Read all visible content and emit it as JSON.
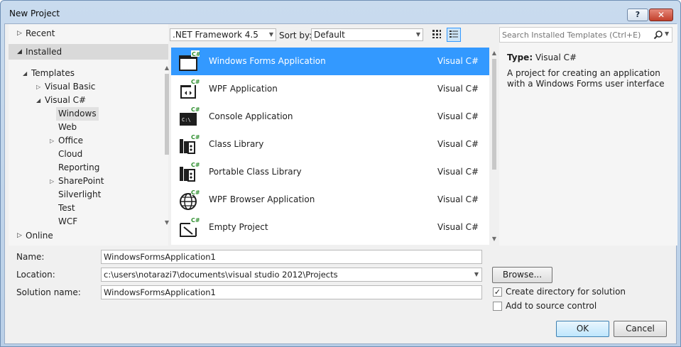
{
  "window": {
    "title": "New Project",
    "help_label": "?",
    "close_label": "✕"
  },
  "nav": {
    "recent": "Recent",
    "installed": "Installed",
    "online": "Online",
    "tree": [
      {
        "label": "Templates",
        "arrow": "◢"
      },
      {
        "label": "Visual Basic",
        "arrow": "▷"
      },
      {
        "label": "Visual C#",
        "arrow": "◢"
      },
      {
        "label": "Windows",
        "arrow": ""
      },
      {
        "label": "Web",
        "arrow": ""
      },
      {
        "label": "Office",
        "arrow": "▷"
      },
      {
        "label": "Cloud",
        "arrow": ""
      },
      {
        "label": "Reporting",
        "arrow": ""
      },
      {
        "label": "SharePoint",
        "arrow": "▷"
      },
      {
        "label": "Silverlight",
        "arrow": ""
      },
      {
        "label": "Test",
        "arrow": ""
      },
      {
        "label": "WCF",
        "arrow": ""
      }
    ]
  },
  "toolbar": {
    "framework": ".NET Framework 4.5",
    "sort_by_label": "Sort by:",
    "sort_value": "Default"
  },
  "templates": [
    {
      "name": "Windows Forms Application",
      "lang": "Visual C#",
      "icon": "windows-form-icon",
      "selected": true
    },
    {
      "name": "WPF Application",
      "lang": "Visual C#",
      "icon": "wpf-app-icon"
    },
    {
      "name": "Console Application",
      "lang": "Visual C#",
      "icon": "console-icon",
      "console_text": "C:\\"
    },
    {
      "name": "Class Library",
      "lang": "Visual C#",
      "icon": "class-library-icon"
    },
    {
      "name": "Portable Class Library",
      "lang": "Visual C#",
      "icon": "portable-library-icon"
    },
    {
      "name": "WPF Browser Application",
      "lang": "Visual C#",
      "icon": "globe-icon"
    },
    {
      "name": "Empty Project",
      "lang": "Visual C#",
      "icon": "empty-project-icon"
    }
  ],
  "icon_badge": "C#",
  "info": {
    "search_placeholder": "Search Installed Templates (Ctrl+E)",
    "type_label": "Type:",
    "type_value": "Visual C#",
    "description": "A project for creating an application with a Windows Forms user interface"
  },
  "form": {
    "name_label": "Name:",
    "name_value": "WindowsFormsApplication1",
    "location_label": "Location:",
    "location_value": "c:\\users\\notarazi7\\documents\\visual studio 2012\\Projects",
    "solution_label": "Solution name:",
    "solution_value": "WindowsFormsApplication1",
    "browse_label": "Browse...",
    "create_dir_label": "Create directory for solution",
    "create_dir_checked": true,
    "source_control_label": "Add to source control",
    "source_control_checked": false,
    "ok_label": "OK",
    "cancel_label": "Cancel"
  },
  "colors": {
    "selection": "#3399ff",
    "badge_green": "#2f8f2f"
  }
}
